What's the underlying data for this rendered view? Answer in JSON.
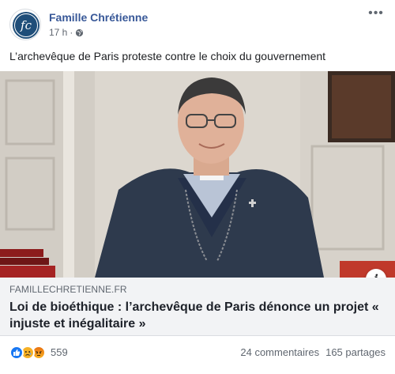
{
  "post": {
    "page_name": "Famille Chrétienne",
    "timestamp": "17 h",
    "separator": "·",
    "caption": "L’archevêque de Paris proteste contre le choix du gouvernement",
    "more_label": "•••",
    "avatar_letters": "fc"
  },
  "link_preview": {
    "domain": "FAMILLECHRETIENNE.FR",
    "headline": "Loi de bioéthique : l’archevêque de Paris dénonce un projet « injuste et inégalitaire »",
    "info_label": "i"
  },
  "footer": {
    "reaction_count": "559",
    "comments": "24 commentaires",
    "shares": "165 partages",
    "reaction_icons": [
      "like-icon",
      "sad-icon",
      "angry-icon"
    ]
  },
  "colors": {
    "page_name": "#385898",
    "link_background": "#f2f3f5",
    "like": "#1877f2",
    "sad": "#f7b125",
    "angry": "#e9710f"
  }
}
